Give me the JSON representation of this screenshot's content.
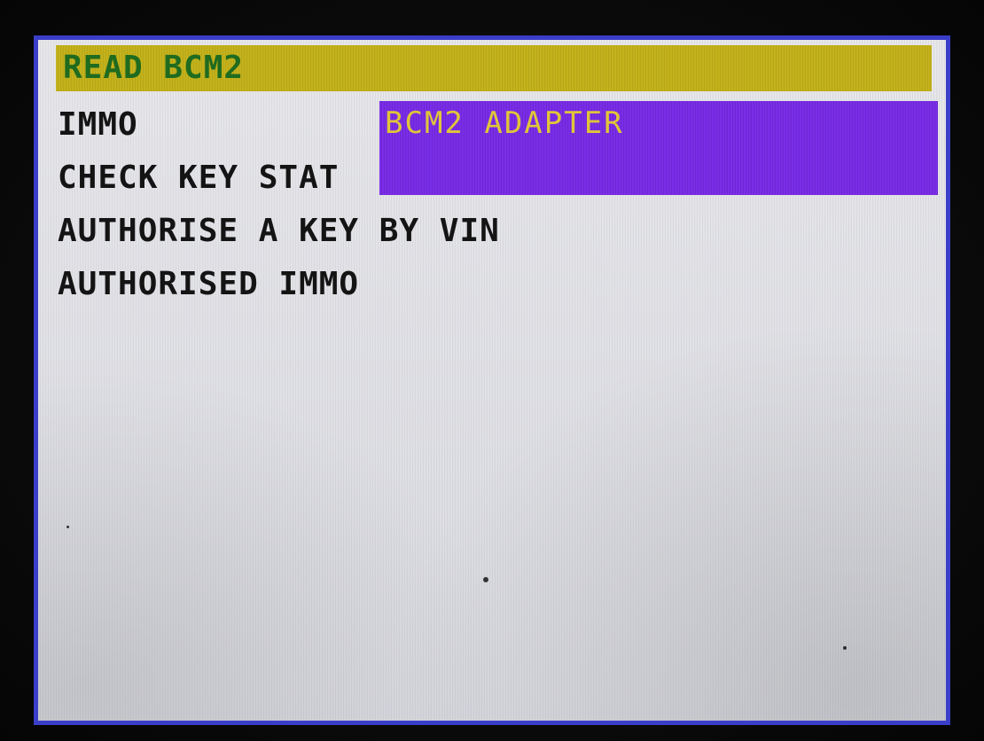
{
  "device": {
    "screen_border_color": "#3a3ec8"
  },
  "menu": {
    "items": [
      {
        "label": "READ BCM2",
        "selected": true
      },
      {
        "label": "IMMO",
        "selected": false
      },
      {
        "label": "CHECK KEY STAT",
        "selected": false
      },
      {
        "label": "AUTHORISE A KEY BY VIN",
        "selected": false
      },
      {
        "label": "AUTHORISED IMMO",
        "selected": false
      }
    ],
    "selected_color": "#c4b21c",
    "selected_text_color": "#1f6b1f"
  },
  "popup": {
    "title": "BCM2 ADAPTER",
    "background_color": "#7a2ee8",
    "text_color": "#e0c53a"
  }
}
